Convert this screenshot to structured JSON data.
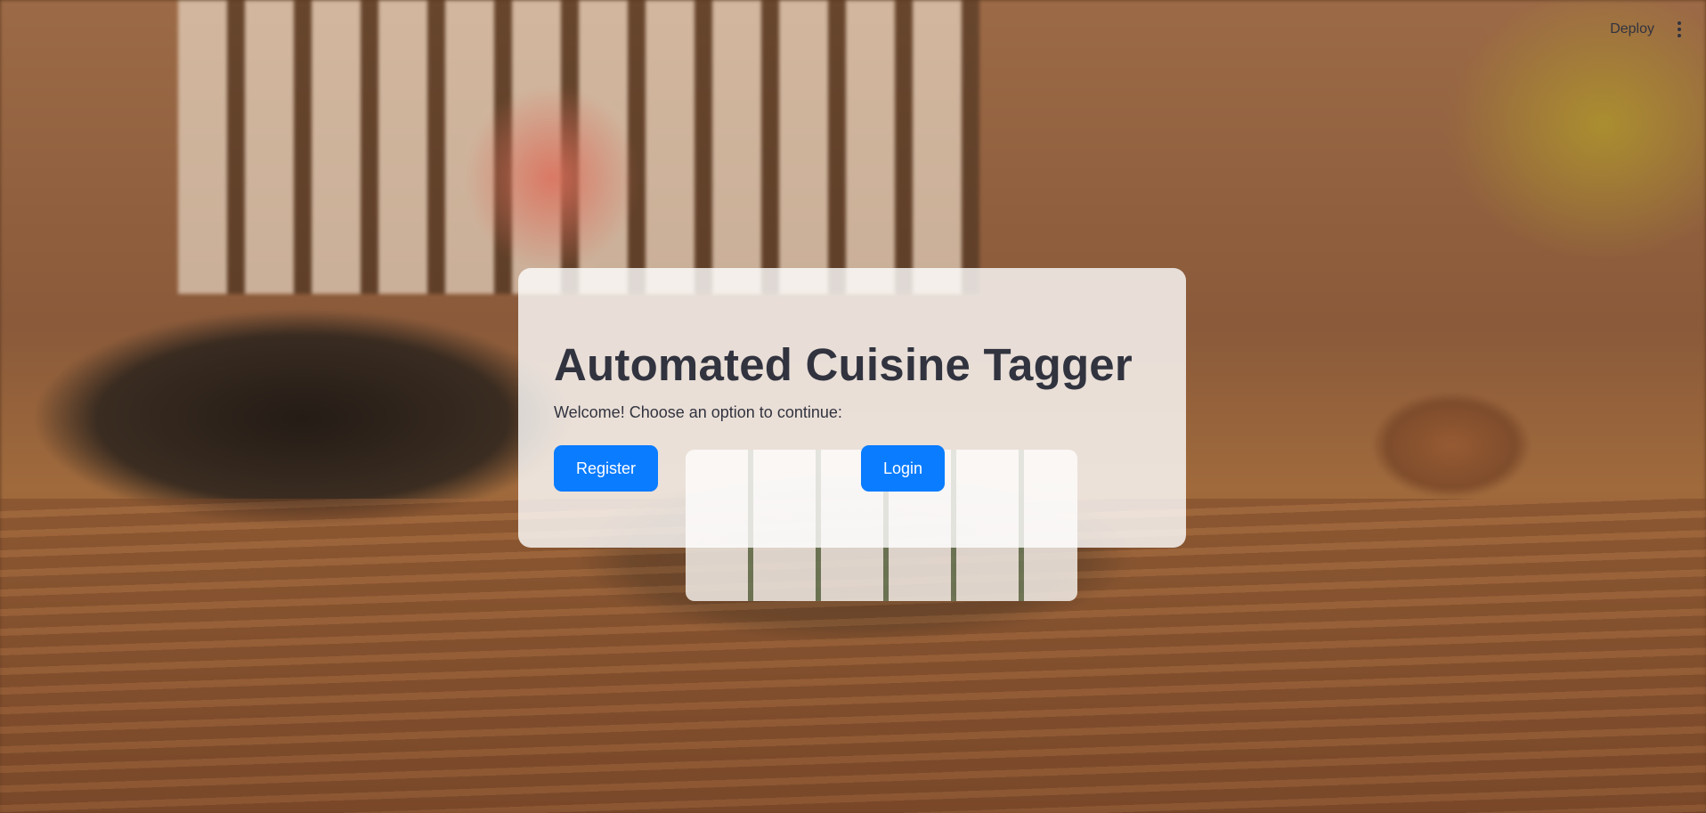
{
  "header": {
    "deploy_label": "Deploy",
    "menu_icon": "kebab-menu-icon"
  },
  "main": {
    "title": "Automated Cuisine Tagger",
    "subtitle": "Welcome! Choose an option to continue:",
    "register_label": "Register",
    "login_label": "Login"
  },
  "colors": {
    "primary_button": "#0a7cff",
    "text": "#31333f",
    "card_background": "rgba(255,255,255,0.80)"
  }
}
